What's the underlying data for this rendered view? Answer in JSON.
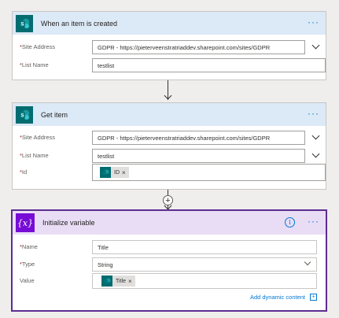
{
  "trigger": {
    "title": "When an item is created",
    "more_label": "···",
    "site_address": {
      "label": "Site Address",
      "value": "GDPR - https://pieterveenstratriaddev.sharepoint.com/sites/GDPR"
    },
    "list_name": {
      "label": "List Name",
      "value": "testlist"
    }
  },
  "get_item": {
    "title": "Get item",
    "more_label": "···",
    "site_address": {
      "label": "Site Address",
      "value": "GDPR - https://pieterveenstratriaddev.sharepoint.com/sites/GDPR"
    },
    "list_name": {
      "label": "List Name",
      "value": "testlist"
    },
    "id": {
      "label": "Id",
      "token": "ID",
      "remove": "×"
    }
  },
  "add_step_symbol": "+",
  "init_var": {
    "title": "Initialize variable",
    "icon_text": "{x}",
    "info_text": "i",
    "more_label": "···",
    "name": {
      "label": "Name",
      "value": "Title"
    },
    "type": {
      "label": "Type",
      "value": "String"
    },
    "value": {
      "label": "Value",
      "token": "Title",
      "remove": "×"
    },
    "add_dynamic": "Add dynamic content",
    "add_dynamic_icon": "+"
  },
  "required_mark": "*",
  "icons": [
    "sharepoint-icon",
    "variable-icon",
    "info-icon",
    "chevron-down-icon",
    "close-icon",
    "plus-icon"
  ],
  "colors": {
    "accent": "#0078d4",
    "sharepoint": "#036c70",
    "variable": "#770bd6",
    "variable_border": "#5c2d91"
  }
}
